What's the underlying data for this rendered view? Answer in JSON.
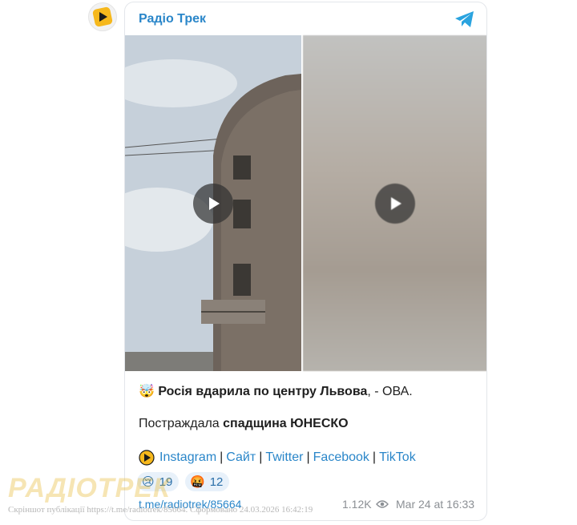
{
  "channel": {
    "name": "Радіо Трек"
  },
  "post": {
    "emoji_headline": "🤯",
    "headline_bold": "Росія вдарила по центру Львова",
    "headline_rest": ", - ОВА.",
    "line2_prefix": "Постраждала ",
    "line2_bold": "спадщина ЮНЕСКО",
    "links": [
      "Instagram",
      "Сайт",
      "Twitter",
      "Facebook",
      "TikTok"
    ],
    "separator": "|"
  },
  "reactions": [
    {
      "emoji": "😢",
      "count": "19"
    },
    {
      "emoji": "🤬",
      "count": "12"
    }
  ],
  "footer": {
    "link": "t.me/radiotrek/85664",
    "views": "1.12K",
    "datetime": "Mar 24 at 16:33"
  },
  "watermark": "РАДІОТРЕК",
  "screenshot_caption": "Скріншот публікації https://t.me/radiotrek/85664. Сформовано 24.03.2026 16:42:19",
  "colors": {
    "accent": "#2a86c9",
    "reaction_bg": "#e8f1fa"
  },
  "icons": [
    "radiotrek-logo-icon",
    "telegram-icon",
    "play-icon",
    "eye-icon"
  ]
}
